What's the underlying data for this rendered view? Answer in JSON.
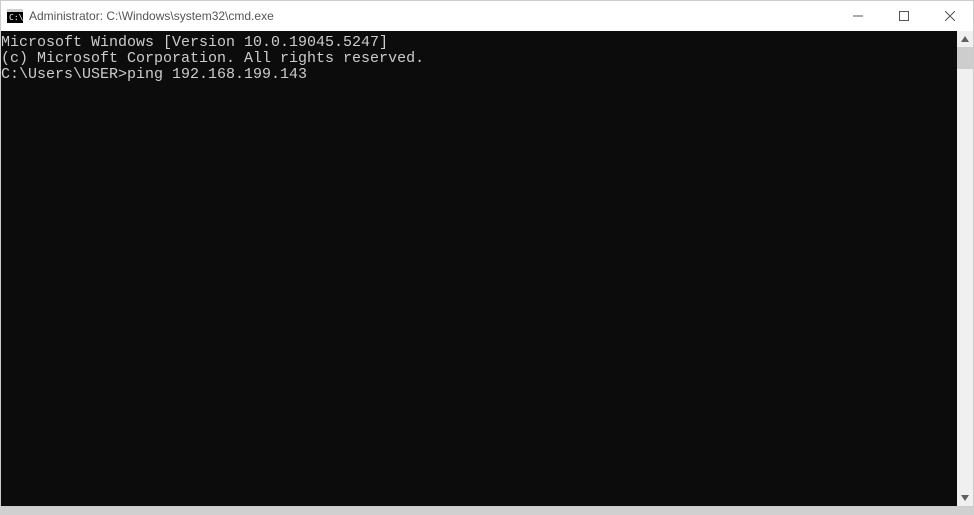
{
  "window": {
    "title": "Administrator: C:\\Windows\\system32\\cmd.exe"
  },
  "terminal": {
    "line1": "Microsoft Windows [Version 10.0.19045.5247]",
    "line2": "(c) Microsoft Corporation. All rights reserved.",
    "blank": "",
    "prompt": "C:\\Users\\USER>",
    "command": "ping 192.168.199.143"
  }
}
